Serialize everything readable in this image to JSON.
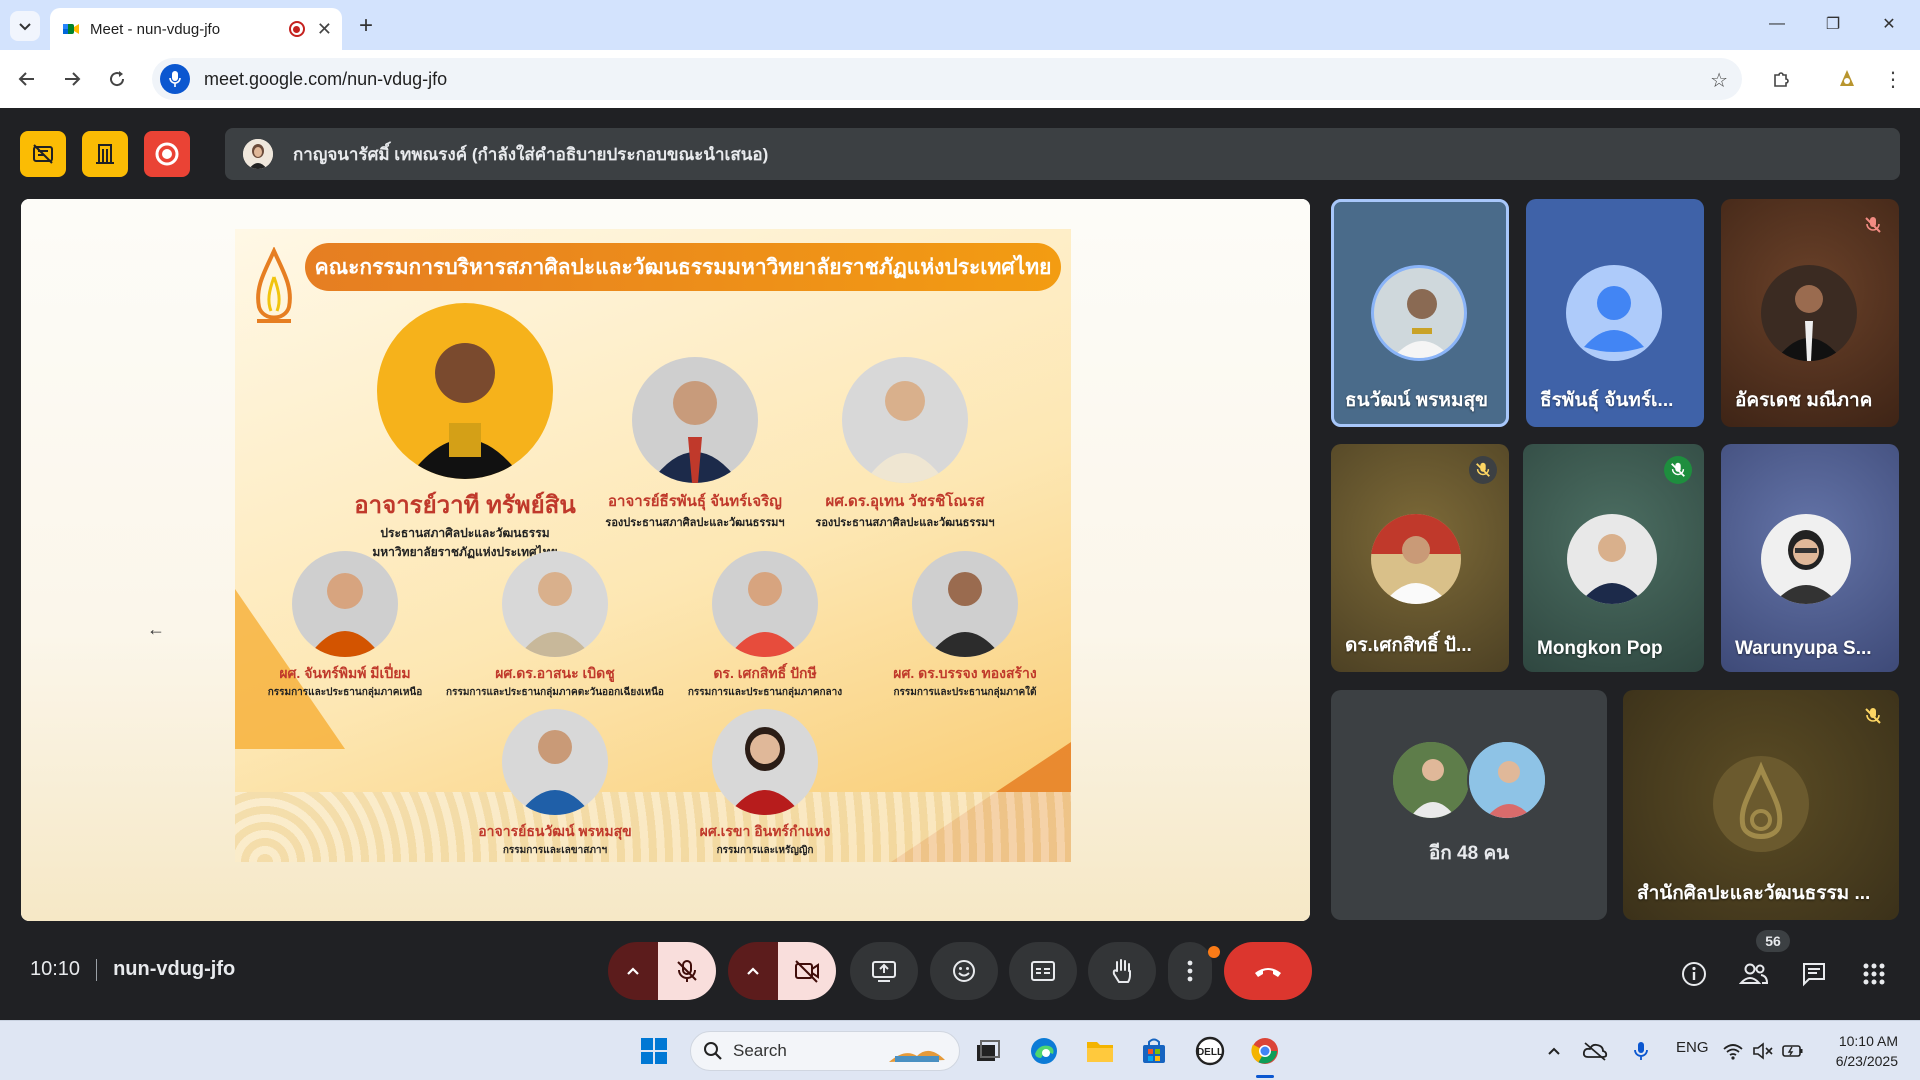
{
  "browser": {
    "tab_title": "Meet - nun-vdug-jfo",
    "url": "meet.google.com/nun-vdug-jfo"
  },
  "meet": {
    "presenter_banner": "กาญจนารัศมิ์ เทพณรงค์ (กำลังใส่คำอธิบายประกอบขณะนำเสนอ)",
    "time": "10:10",
    "meeting_code": "nun-vdug-jfo",
    "participant_count": "56",
    "others_label": "อีก 48 คน"
  },
  "slide": {
    "title": "คณะกรรมการบริหารสภาศิลปะและวัฒนธรรมมหาวิทยาลัยราชภัฏแห่งประเทศไทย",
    "people": [
      {
        "name": "อาจารย์วาที ทรัพย์สิน",
        "role": "ประธานสภาศิลปะและวัฒนธรรม",
        "role2": "มหาวิทยาลัยราชภัฏแห่งประเทศไทย"
      },
      {
        "name": "อาจารย์ธีรพันธุ์ จันทร์เจริญ",
        "role": "รองประธานสภาศิลปะและวัฒนธรรมฯ"
      },
      {
        "name": "ผศ.ดร.อุเทน วัชรชิโณรส",
        "role": "รองประธานสภาศิลปะและวัฒนธรรมฯ"
      },
      {
        "name": "ผศ. จันทร์พิมพ์ มีเปี่ยม",
        "role": "กรรมการและประธานกลุ่มภาคเหนือ"
      },
      {
        "name": "ผศ.ดร.อาสนะ เบิดชู",
        "role": "กรรมการและประธานกลุ่มภาคตะวันออกเฉียงเหนือ"
      },
      {
        "name": "ดร. เศกสิทธิ์ ปักษี",
        "role": "กรรมการและประธานกลุ่มภาคกลาง"
      },
      {
        "name": "ผศ. ดร.บรรจง ทองสร้าง",
        "role": "กรรมการและประธานกลุ่มภาคใต้"
      },
      {
        "name": "อาจารย์ธนวัฒน์ พรหมสุข",
        "role": "กรรมการและเลขาสภาฯ"
      },
      {
        "name": "ผศ.เรขา อินทร์กำแหง",
        "role": "กรรมการและเหรัญญิก"
      }
    ]
  },
  "tiles": [
    {
      "name": "ธนวัฒน์ พรหมสุข",
      "bg": "#4a6b8a"
    },
    {
      "name": "ธีรพันธุ์ จันทร์เ...",
      "bg": "#3f62a8"
    },
    {
      "name": "อัครเดช มณีภาค",
      "bg": "#5a3422"
    },
    {
      "name": "ดร.เศกสิทธิ์ ปั...",
      "bg": "#6e5a2e"
    },
    {
      "name": "Mongkon Pop",
      "bg": "#3e5e52"
    },
    {
      "name": "Warunyupa S...",
      "bg": "#4e5d8f"
    },
    {
      "name": "สำนักศิลปะและวัฒนธรรม ...",
      "bg": "#4a3f1f"
    }
  ],
  "taskbar": {
    "search_label": "Search",
    "lang": "ENG",
    "clock_time": "10:10 AM",
    "clock_date": "6/23/2025"
  }
}
